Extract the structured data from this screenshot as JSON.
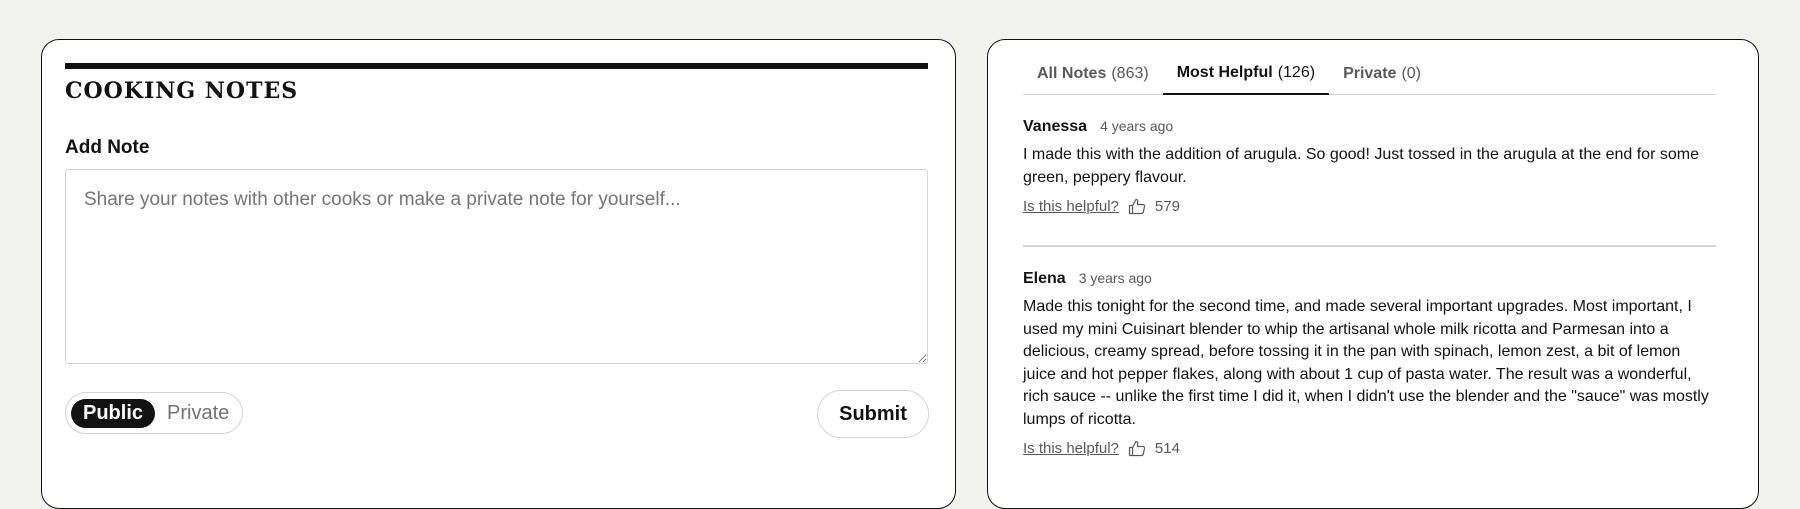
{
  "notes_form": {
    "title": "COOKING NOTES",
    "add_note_label": "Add Note",
    "placeholder": "Share your notes with other cooks or make a private note for yourself...",
    "visibility": {
      "public_label": "Public",
      "private_label": "Private",
      "selected": "Public"
    },
    "submit_label": "Submit"
  },
  "notes_list": {
    "tabs": [
      {
        "label": "All Notes",
        "count": "(863)"
      },
      {
        "label": "Most Helpful",
        "count": "(126)"
      },
      {
        "label": "Private",
        "count": "(0)"
      }
    ],
    "active_tab": "Most Helpful",
    "notes": [
      {
        "author": "Vanessa",
        "time": "4 years ago",
        "text": "I made this with the addition of arugula. So good! Just tossed in the arugula at the end for some green, peppery flavour.",
        "helpful_label": "Is this helpful?",
        "helpful_count": "579"
      },
      {
        "author": "Elena",
        "time": "3 years ago",
        "text": "Made this tonight for the second time, and made several important upgrades. Most important, I used my mini Cuisinart blender to whip the artisanal whole milk ricotta and Parmesan into a delicious, creamy spread, before tossing it in the pan with spinach, lemon zest, a bit of lemon juice and hot pepper flakes, along with about 1 cup of pasta water. The result was a wonderful, rich sauce -- unlike the first time I did it, when I didn't use the blender and the \"sauce\" was mostly lumps of ricotta.",
        "helpful_label": "Is this helpful?",
        "helpful_count": "514"
      }
    ]
  },
  "icons": {
    "helpful": "thumbs-up-icon"
  },
  "colors": {
    "ink": "#121212",
    "muted": "#5a5a5a",
    "border": "#d4d4d4",
    "page_bg": "#f2f2ee"
  }
}
